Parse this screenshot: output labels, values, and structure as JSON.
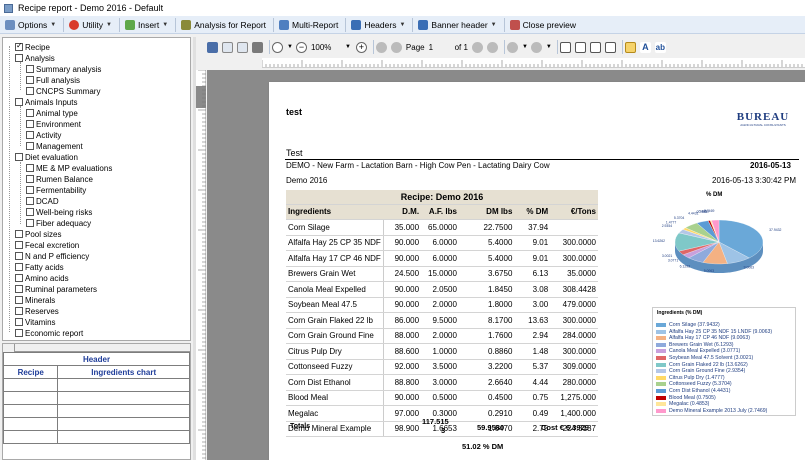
{
  "window": {
    "title": "Recipe report - Demo 2016 - Default"
  },
  "menubar": {
    "options": "Options",
    "utility": "Utility",
    "insert": "Insert",
    "analysis_for_report": "Analysis for Report",
    "multi_report": "Multi-Report",
    "headers": "Headers",
    "banner_header": "Banner header",
    "close_preview": "Close preview"
  },
  "tree": {
    "items": [
      {
        "label": "Recipe",
        "checked": true
      },
      {
        "label": "Analysis"
      },
      {
        "label": "Summary analysis"
      },
      {
        "label": "Full analysis"
      },
      {
        "label": "CNCPS Summary"
      },
      {
        "label": "Animals Inputs"
      },
      {
        "label": "Animal type"
      },
      {
        "label": "Environment"
      },
      {
        "label": "Activity"
      },
      {
        "label": "Management"
      },
      {
        "label": "Diet evaluation"
      },
      {
        "label": "ME & MP evaluations"
      },
      {
        "label": "Rumen Balance"
      },
      {
        "label": "Fermentability"
      },
      {
        "label": "DCAD"
      },
      {
        "label": "Well-being risks"
      },
      {
        "label": "Fiber adequacy"
      },
      {
        "label": "Pool sizes"
      },
      {
        "label": "Fecal excretion"
      },
      {
        "label": "N and P efficiency"
      },
      {
        "label": "Fatty acids"
      },
      {
        "label": "Amino acids"
      },
      {
        "label": "Ruminal parameters"
      },
      {
        "label": "Minerals"
      },
      {
        "label": "Reserves"
      },
      {
        "label": "Vitamins"
      },
      {
        "label": "Economic report"
      }
    ]
  },
  "header_panel": {
    "title": "Header",
    "col1": "Recipe",
    "col2": "Ingredients chart"
  },
  "toolbar": {
    "zoom": "100%",
    "page_label": "Page",
    "page_num": "1",
    "page_of": "of 1"
  },
  "report": {
    "test_label": "test",
    "test_title": "Test",
    "farm_line": "DEMO - New Farm - Lactation Barn - High Cow Pen - Lactating Dairy Cow",
    "date": "2016-05-13",
    "recipe_name": "Demo 2016",
    "datetime": "2016-05-13 3:30:42 PM",
    "logo_text": "BUREAU",
    "logo_sub": "AGRICULTURAL CONSULTANTS",
    "table_title": "Recipe: Demo 2016",
    "headers": [
      "Ingredients",
      "D.M.",
      "A.F. lbs",
      "DM lbs",
      "% DM",
      "€/Tons"
    ],
    "rows": [
      [
        "Corn Silage",
        "35.000",
        "65.0000",
        "22.7500",
        "37.94",
        ""
      ],
      [
        "Alfalfa Hay 25 CP 35 NDF",
        "90.000",
        "6.0000",
        "5.4000",
        "9.01",
        "300.0000"
      ],
      [
        "Alfalfa Hay 17 CP 46 NDF",
        "90.000",
        "6.0000",
        "5.4000",
        "9.01",
        "300.0000"
      ],
      [
        "Brewers Grain Wet",
        "24.500",
        "15.0000",
        "3.6750",
        "6.13",
        "35.0000"
      ],
      [
        "Canola Meal Expelled",
        "90.000",
        "2.0500",
        "1.8450",
        "3.08",
        "308.4428"
      ],
      [
        "Soybean Meal 47.5",
        "90.000",
        "2.0000",
        "1.8000",
        "3.00",
        "479.0000"
      ],
      [
        "Corn Grain Flaked 22 lb",
        "86.000",
        "9.5000",
        "8.1700",
        "13.63",
        "300.0000"
      ],
      [
        "Corn Grain Ground Fine",
        "88.000",
        "2.0000",
        "1.7600",
        "2.94",
        "284.0000"
      ],
      [
        "Citrus Pulp Dry",
        "88.600",
        "1.0000",
        "0.8860",
        "1.48",
        "300.0000"
      ],
      [
        "Cottonseed Fuzzy",
        "92.000",
        "3.5000",
        "3.2200",
        "5.37",
        "309.0000"
      ],
      [
        "Corn Dist Ethanol",
        "88.800",
        "3.0000",
        "2.6640",
        "4.44",
        "280.0000"
      ],
      [
        "Blood Meal",
        "90.000",
        "0.5000",
        "0.4500",
        "0.75",
        "1,275.000"
      ],
      [
        "Megalac",
        "97.000",
        "0.3000",
        "0.2910",
        "0.49",
        "1,400.000"
      ],
      [
        "Demo Mineral Example",
        "98.900",
        "1.6653",
        "1.6470",
        "2.75",
        "224.3137"
      ]
    ],
    "totals_label": "Totals",
    "totals_af_1": "117.515",
    "totals_af_2": "3",
    "totals_dm": "59.9580",
    "totals_cost": "Cost € 6.3929",
    "dm_percent": "51.02 % DM"
  },
  "chart": {
    "title": "% DM",
    "legend_title": "Ingredients (% DM)",
    "slice_labels": [
      "37.9432",
      "9.0063",
      "9.0063",
      "6.1293",
      "3.0771",
      "3.0021",
      "13.6262",
      "2.9354",
      "1.4777",
      "5.3704",
      "4.4431",
      "0.7505",
      "0.4853",
      "2.7469"
    ],
    "colors": [
      "#6aa8d8",
      "#9ec3e6",
      "#f4b183",
      "#8faadc",
      "#c9a0dc",
      "#e06666",
      "#7fc8c8",
      "#b4c7e7",
      "#ffd966",
      "#a9d18e",
      "#5b9bd5",
      "#c00000",
      "#ffe699",
      "#ff99cc"
    ],
    "legend": [
      "Corn Silage (37.9432)",
      "Alfalfa Hay 25 CP 35 NDF 15 LNDF (9.0063)",
      "Alfalfa Hay 17 CP 46 NDF (9.0063)",
      "Brewers Grain Wet (6.1293)",
      "Canola Meal Expelled (3.0771)",
      "Soybean Meal 47.5 Solvent (3.0021)",
      "Corn Grain Flaked 22 lb (13.6262)",
      "Corn Grain Ground Fine (2.9354)",
      "Citrus Pulp Dry (1.4777)",
      "Cottonseed Fuzzy (5.3704)",
      "Corn Dist Ethanol (4.4431)",
      "Blood Meal (0.7505)",
      "Megalac (0.4853)",
      "Demo Mineral Example 2013 July (2.7469)"
    ]
  }
}
